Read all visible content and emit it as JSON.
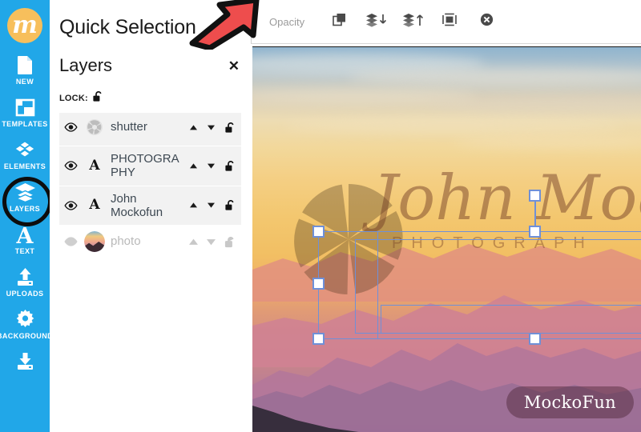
{
  "app": {
    "brand_letter": "m",
    "brand_color": "#f7bf5c",
    "sidebar_color": "#21a7e8"
  },
  "sidebar": {
    "items": [
      {
        "label": "NEW",
        "icon": "page-icon",
        "active": false
      },
      {
        "label": "TEMPLATES",
        "icon": "templates-icon",
        "active": false
      },
      {
        "label": "ELEMENTS",
        "icon": "elements-icon",
        "active": false
      },
      {
        "label": "LAYERS",
        "icon": "layers-icon",
        "active": true
      },
      {
        "label": "TEXT",
        "icon": "text-icon",
        "active": false
      },
      {
        "label": "UPLOADS",
        "icon": "upload-icon",
        "active": false
      },
      {
        "label": "BACKGROUND",
        "icon": "gear-icon",
        "active": false
      },
      {
        "label": "",
        "icon": "download-icon",
        "active": false
      }
    ]
  },
  "panel": {
    "title": "Quick Selection",
    "layers_heading": "Layers",
    "close_label": "✕",
    "lock_label": "LOCK:",
    "layers": [
      {
        "name": "shutter",
        "thumb": "shutter-thumb",
        "visible": true,
        "locked": false,
        "dim": false
      },
      {
        "name": "PHOTOGRAPHY",
        "thumb": "A",
        "visible": true,
        "locked": false,
        "dim": false
      },
      {
        "name": "John Mockofun",
        "thumb": "A",
        "visible": true,
        "locked": false,
        "dim": false
      },
      {
        "name": "photo",
        "thumb": "photo-thumb",
        "visible": true,
        "locked": false,
        "dim": true
      }
    ]
  },
  "toolbar": {
    "opacity_label": "Opacity",
    "buttons": [
      {
        "name": "duplicate-button",
        "icon": "duplicate-icon"
      },
      {
        "name": "send-backward-button",
        "icon": "layers-down-icon"
      },
      {
        "name": "bring-forward-button",
        "icon": "layers-up-icon"
      },
      {
        "name": "frame-button",
        "icon": "frame-icon"
      },
      {
        "name": "delete-button",
        "icon": "delete-circle-icon"
      }
    ]
  },
  "canvas": {
    "watermark_script": "John Moc",
    "watermark_sub": "PHOTOGRAPH",
    "badge_label": "MockoFun",
    "selection_color": "#6f90d8"
  },
  "annotation": {
    "arrow_color": "#ee4d4d",
    "arrow_outline": "#111111"
  }
}
